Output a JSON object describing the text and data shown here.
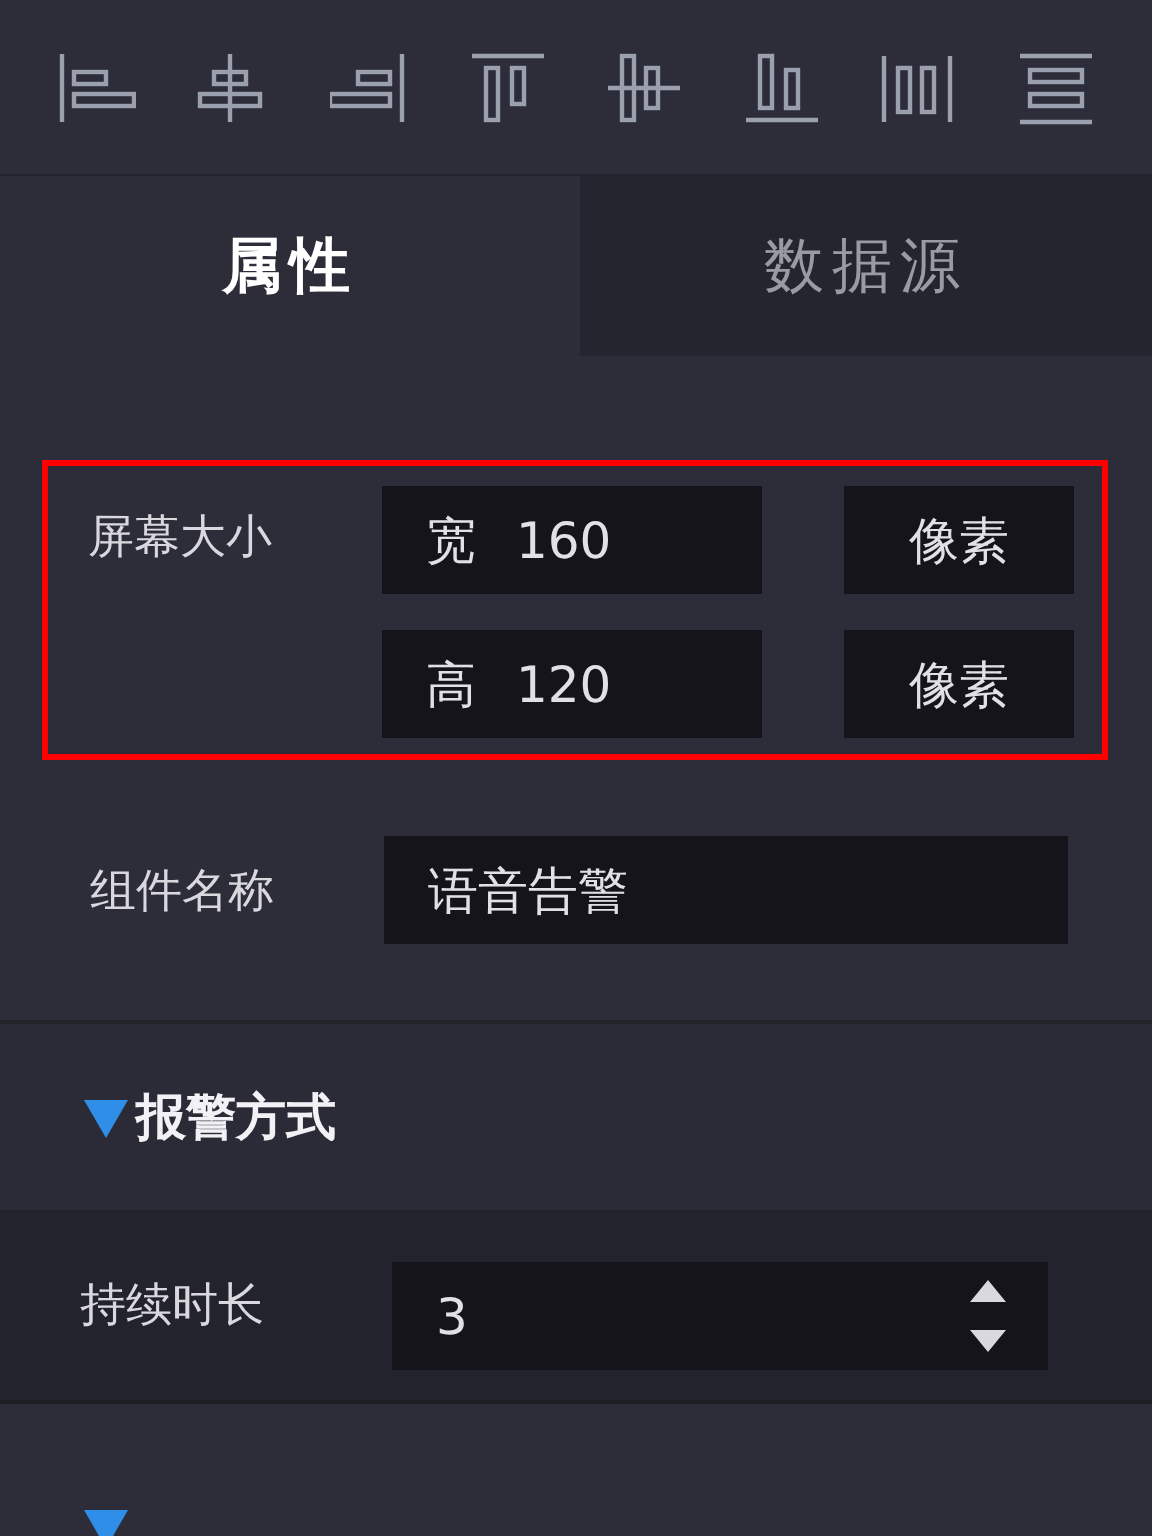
{
  "toolbar": {
    "icons": [
      {
        "kind": "align-left"
      },
      {
        "kind": "align-hcenter"
      },
      {
        "kind": "align-right"
      },
      {
        "kind": "align-top"
      },
      {
        "kind": "align-vcenter"
      },
      {
        "kind": "align-bottom"
      },
      {
        "kind": "distribute-h"
      },
      {
        "kind": "distribute-v"
      }
    ]
  },
  "tabs": [
    {
      "label": "属性",
      "selected": true
    },
    {
      "label": "数据源",
      "selected": false
    }
  ],
  "screen_size": {
    "label": "屏幕大小",
    "highlighted": true,
    "rows": [
      {
        "prefix": "宽",
        "value": "160",
        "unit": "像素"
      },
      {
        "prefix": "高",
        "value": "120",
        "unit": "像素"
      }
    ]
  },
  "component_name": {
    "label": "组件名称",
    "value": "语音告警"
  },
  "alarm_section": {
    "title": "报警方式",
    "expanded": true,
    "duration": {
      "label": "持续时长",
      "value": "3"
    }
  },
  "next_section": {
    "expanded": true
  }
}
